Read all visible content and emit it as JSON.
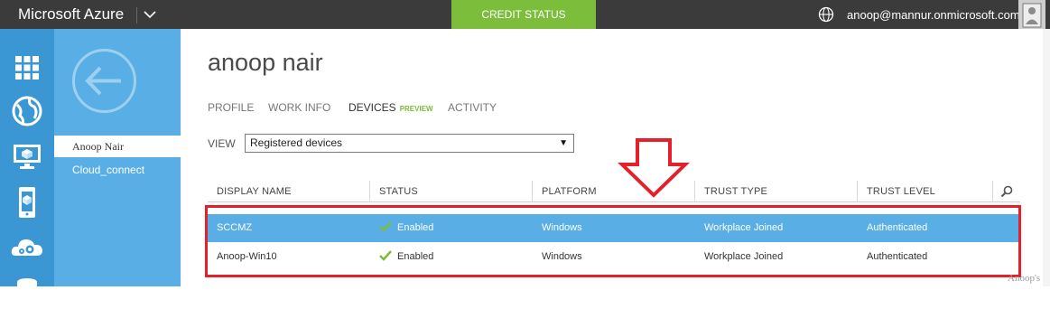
{
  "header": {
    "brand": "Microsoft Azure",
    "credit_status": "CREDIT STATUS",
    "user_email": "anoop@mannur.onmicrosoft.com"
  },
  "sidebar": {
    "icons": [
      "grid-icon",
      "globe-network-icon",
      "virtual-machine-icon",
      "mobile-service-icon",
      "cloud-services-icon",
      "database-icon"
    ]
  },
  "subnav": {
    "items": [
      {
        "label": "Anoop Nair",
        "active": true
      },
      {
        "label": "Cloud_connect",
        "active": false
      }
    ]
  },
  "main": {
    "title": "anoop nair",
    "tabs": [
      {
        "label": "PROFILE"
      },
      {
        "label": "WORK INFO"
      },
      {
        "label": "DEVICES",
        "badge": "PREVIEW",
        "active": true
      },
      {
        "label": "ACTIVITY"
      }
    ],
    "view_label": "VIEW",
    "view_selected": "Registered devices"
  },
  "table": {
    "columns": [
      "DISPLAY NAME",
      "STATUS",
      "PLATFORM",
      "TRUST TYPE",
      "TRUST LEVEL"
    ],
    "rows": [
      {
        "display_name": "SCCMZ",
        "status": "Enabled",
        "platform": "Windows",
        "trust_type": "Workplace Joined",
        "trust_level": "Authenticated",
        "selected": true
      },
      {
        "display_name": "Anoop-Win10",
        "status": "Enabled",
        "platform": "Windows",
        "trust_type": "Workplace Joined",
        "trust_level": "Authenticated",
        "selected": false
      }
    ]
  },
  "annotation": {
    "watermark": "Anoop's"
  },
  "colors": {
    "topbar": "#3b3b3b",
    "credit_green": "#7cbd3c",
    "iconbar_blue": "#3a97d3",
    "subnav_blue": "#59aee5",
    "selected_row": "#59aee5",
    "annotation_red": "#e5202a"
  }
}
